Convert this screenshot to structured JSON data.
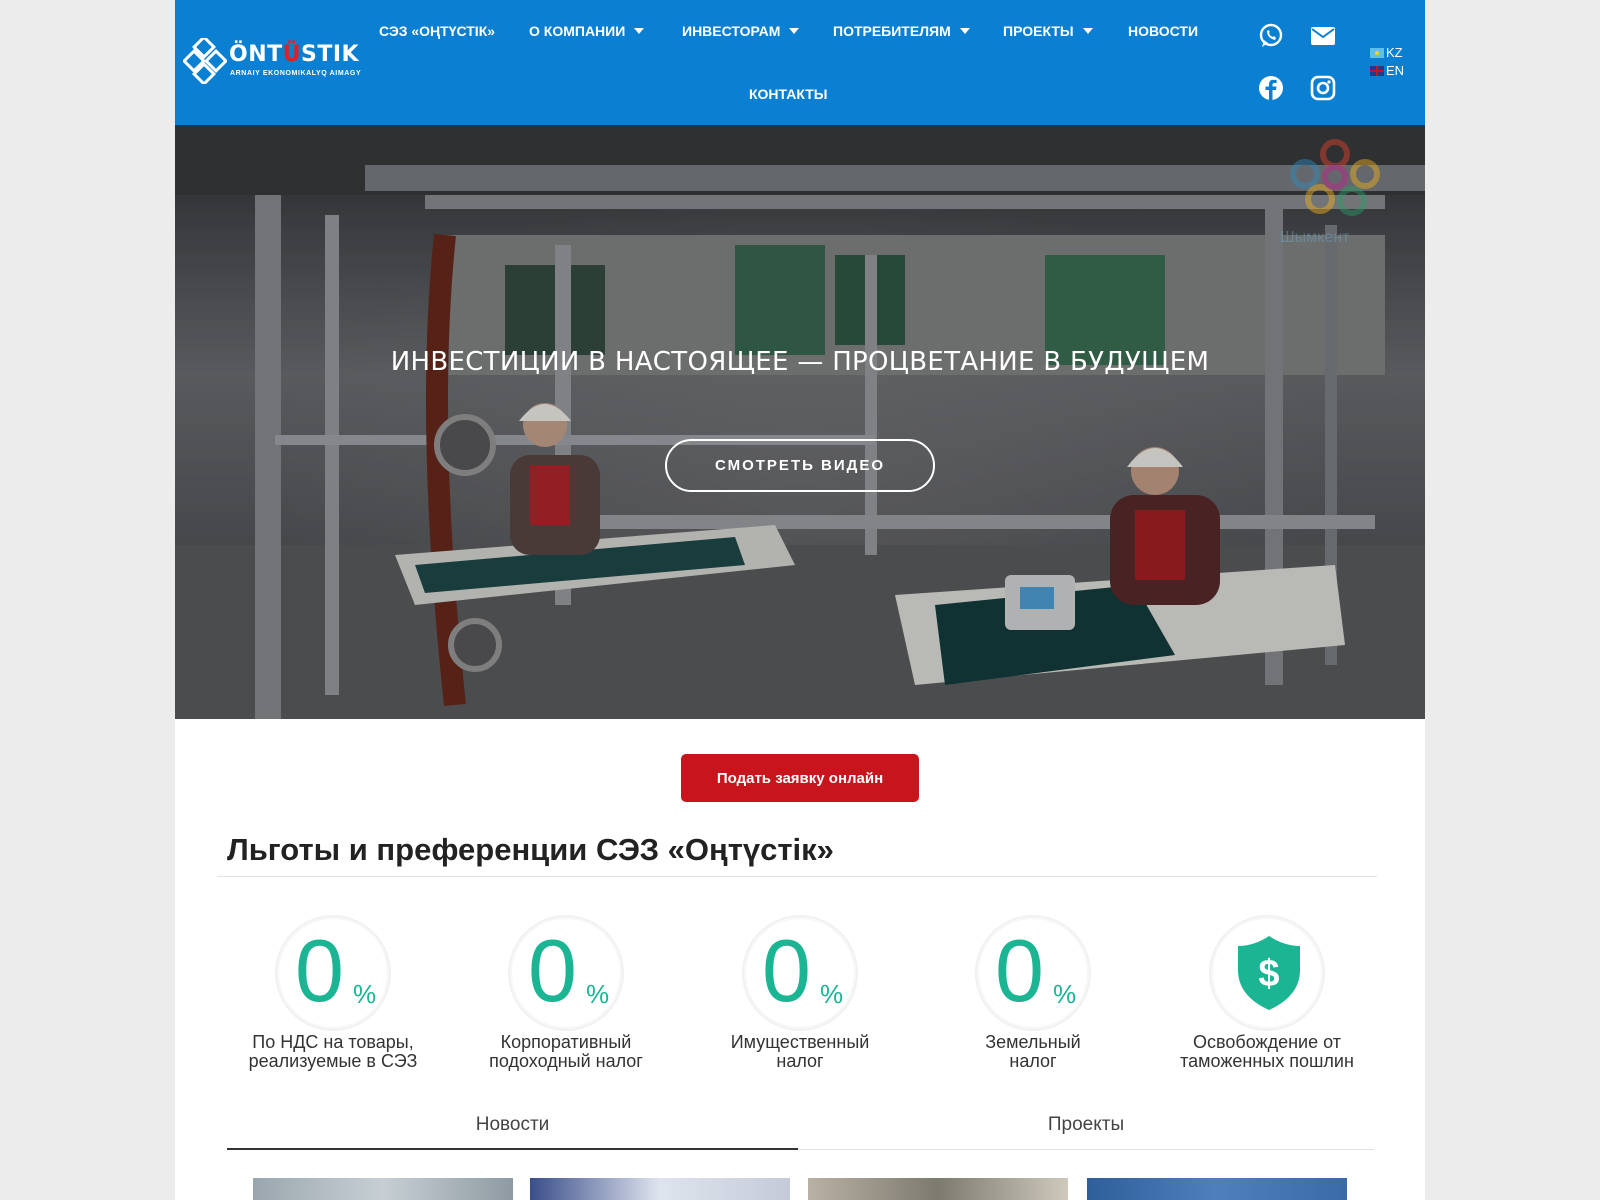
{
  "brand": {
    "logo_word_main": "ÖNT",
    "logo_word_accent": "Ü",
    "logo_word_end": "STIK",
    "logo_tagline": "ARNAIY EKONOMIKALYQ AIMAGY"
  },
  "nav": {
    "items": [
      {
        "label": "СЭЗ «ОҢТҮСТІК»",
        "dropdown": false
      },
      {
        "label": "О КОМПАНИИ",
        "dropdown": true
      },
      {
        "label": "ИНВЕСТОРАМ",
        "dropdown": true
      },
      {
        "label": "ПОТРЕБИТЕЛЯМ",
        "dropdown": true
      },
      {
        "label": "ПРОЕКТЫ",
        "dropdown": true
      },
      {
        "label": "НОВОСТИ",
        "dropdown": false
      }
    ],
    "contacts": "КОНТАКТЫ"
  },
  "social": [
    "whatsapp-icon",
    "mail-icon",
    "facebook-icon",
    "instagram-icon"
  ],
  "languages": [
    "KZ",
    "EN"
  ],
  "hero": {
    "title": "ИНВЕСТИЦИИ В НАСТОЯЩЕЕ — ПРОЦВЕТАНИЕ В БУДУЩЕМ",
    "video_button": "СМОТРЕТЬ ВИДЕО",
    "watermark_text": "Шымкент"
  },
  "apply_button": "Подать заявку онлайн",
  "benefits": {
    "title": "Льготы и преференции СЭЗ «Оңтүстік»",
    "items": [
      {
        "value": "0",
        "unit": "%",
        "line1": "По НДС на товары,",
        "line2": "реализуемые в СЭЗ"
      },
      {
        "value": "0",
        "unit": "%",
        "line1": "Корпоративный",
        "line2": "подоходный налог"
      },
      {
        "value": "0",
        "unit": "%",
        "line1": "Имущественный",
        "line2": "налог"
      },
      {
        "value": "0",
        "unit": "%",
        "line1": "Земельный",
        "line2": "налог"
      },
      {
        "value": "",
        "unit": "",
        "line1": "Освобождение от",
        "line2": "таможенных пошлин",
        "icon": "shield-dollar-icon"
      }
    ]
  },
  "tabs": [
    "Новости",
    "Проекты"
  ],
  "colors": {
    "header": "#0b7fd1",
    "accent_red": "#c8141c",
    "teal": "#1bb594"
  }
}
